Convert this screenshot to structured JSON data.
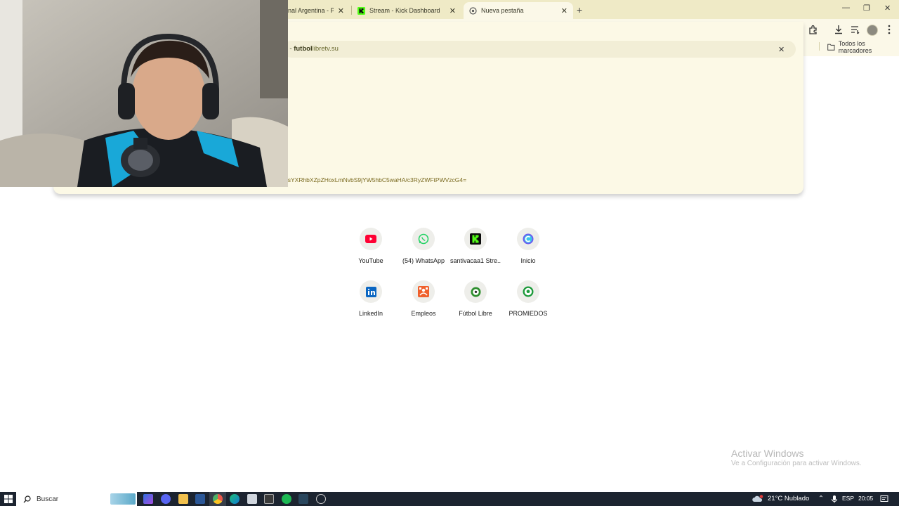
{
  "browser": {
    "tabs": [
      {
        "title": "nal Argentina - PC",
        "active": false
      },
      {
        "title": "Stream - Kick Dashboard",
        "active": false
      },
      {
        "title": "Nueva pestaña",
        "active": true
      }
    ],
    "new_tab_symbol": "+",
    "window_controls": {
      "minimize": "—",
      "restore": "❐",
      "close": "✕"
    }
  },
  "toolbar": {
    "icons": [
      "extensions-icon",
      "download-icon",
      "reading-list-icon",
      "profile-avatar",
      "menu-icon"
    ],
    "bookmarks_all_label": "Todos los marcadores"
  },
  "omnibox": {
    "suggestion": {
      "prefix": "s  -  ",
      "domain_bold": "futbol",
      "domain_rest": "libretv.su"
    },
    "clear_symbol": "✕",
    "url_fragment": "9sYXRhbXZpZHoxLmNvbS9jYW5hbC5waHA/c3RyZWFtPWVzcG4="
  },
  "shortcuts": [
    {
      "label": "YouTube",
      "icon": "youtube-icon"
    },
    {
      "label": "(54) WhatsApp",
      "icon": "whatsapp-icon"
    },
    {
      "label": "santivacaa1 Stre...",
      "icon": "kick-icon"
    },
    {
      "label": "Inicio",
      "icon": "inicio-icon"
    },
    {
      "label": "LinkedIn",
      "icon": "linkedin-icon"
    },
    {
      "label": "Empleos",
      "icon": "empleos-icon"
    },
    {
      "label": "Fútbol Libre",
      "icon": "futbol-libre-icon"
    },
    {
      "label": "PROMIEDOS",
      "icon": "promiedos-icon"
    }
  ],
  "watermark": {
    "title": "Activar Windows",
    "subtitle": "Ve a Configuración para activar Windows."
  },
  "taskbar": {
    "search_placeholder": "Buscar",
    "weather": "21°C  Nublado",
    "language": "ESP",
    "time": "20:05",
    "notification_count": "1"
  },
  "colors": {
    "tabstrip": "#efeac6",
    "toolbar": "#fbf8e8",
    "taskbar": "#1c2430",
    "kick_green": "#53fc18",
    "youtube_red": "#ff0033",
    "whatsapp_green": "#25d366"
  }
}
